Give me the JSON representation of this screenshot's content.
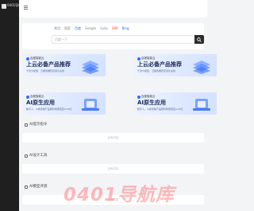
{
  "sidebar": {
    "logo_text": "0401导航",
    "bg": "#1f1f1f"
  },
  "search": {
    "tabs": [
      {
        "label": "常用",
        "state": "normal"
      },
      {
        "label": "搜索",
        "state": "normal"
      },
      {
        "label": "百度",
        "state": "active"
      },
      {
        "label": "Google",
        "state": "normal"
      },
      {
        "label": "Sydy",
        "state": "normal"
      },
      {
        "label": "360",
        "state": "red"
      },
      {
        "label": "Bing",
        "state": "active"
      }
    ],
    "placeholder": "百度一下",
    "button_icon": "search-icon"
  },
  "banners": [
    {
      "brand": "百度智能云",
      "title": "上云必备产品推荐",
      "subtitle": "千款大模型，云服务器稳定持久在线",
      "art": "stacked-tiles"
    },
    {
      "brand": "百度智能云",
      "title": "上云必备产品推荐",
      "subtitle": "千款大模型，云服务器稳定持久在线",
      "art": "stacked-tiles"
    },
    {
      "brand": "百度智能云",
      "title": "AI原生应用",
      "subtitle": "数字人，AI搜索等产品限时特惠低至0.09元",
      "art": "ai-device"
    },
    {
      "brand": "百度智能云",
      "title": "AI原生应用",
      "subtitle": "数字人，AI搜索等产品限时特惠低至0.09元",
      "art": "ai-device"
    }
  ],
  "sections": [
    {
      "title": "AI提示指令",
      "empty_text": "没有内容"
    },
    {
      "title": "AI设计工具",
      "empty_text": "没有内容"
    },
    {
      "title": "AI模型评测",
      "empty_text": "没有内容"
    }
  ],
  "watermark": "0401导航库",
  "colors": {
    "accent": "#2f6bff",
    "highlight": "#e0382e",
    "watermark": "#ff8e8e"
  }
}
